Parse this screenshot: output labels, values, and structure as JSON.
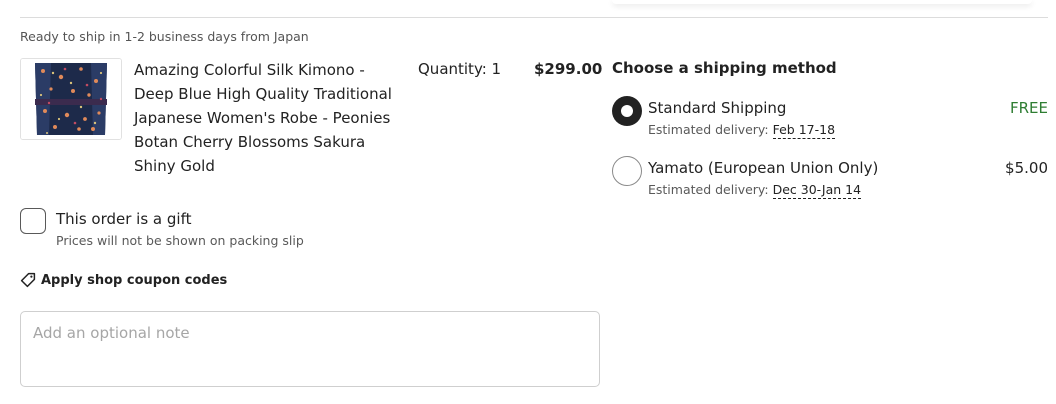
{
  "shop": {
    "ready_to_ship": "Ready to ship in 1-2 business days from Japan"
  },
  "item": {
    "title": "Amazing Colorful Silk Kimono - Deep Blue High Quality Traditional Japanese Women's Robe - Peonies Botan Cherry Blossoms Sakura Shiny Gold",
    "quantity": "Quantity: 1",
    "price": "$299.00",
    "image_icon": "kimono-thumbnail"
  },
  "gift": {
    "label": "This order is a gift",
    "subtext": "Prices will not be shown on packing slip",
    "checked": false
  },
  "coupon": {
    "label": "Apply shop coupon codes",
    "icon": "tag-icon"
  },
  "note": {
    "placeholder": "Add an optional note",
    "value": ""
  },
  "shipping": {
    "heading": "Choose a shipping method",
    "options": [
      {
        "name": "Standard Shipping",
        "price": "FREE",
        "estimate_label": "Estimated delivery:",
        "estimate_date": "Feb 17-18",
        "selected": true
      },
      {
        "name": "Yamato (European Union Only)",
        "price": "$5.00",
        "estimate_label": "Estimated delivery:",
        "estimate_date": "Dec 30-Jan 14",
        "selected": false
      }
    ]
  },
  "colors": {
    "text": "#222222",
    "muted": "#595959",
    "free": "#2e7d32",
    "border": "#cfcfcf"
  }
}
